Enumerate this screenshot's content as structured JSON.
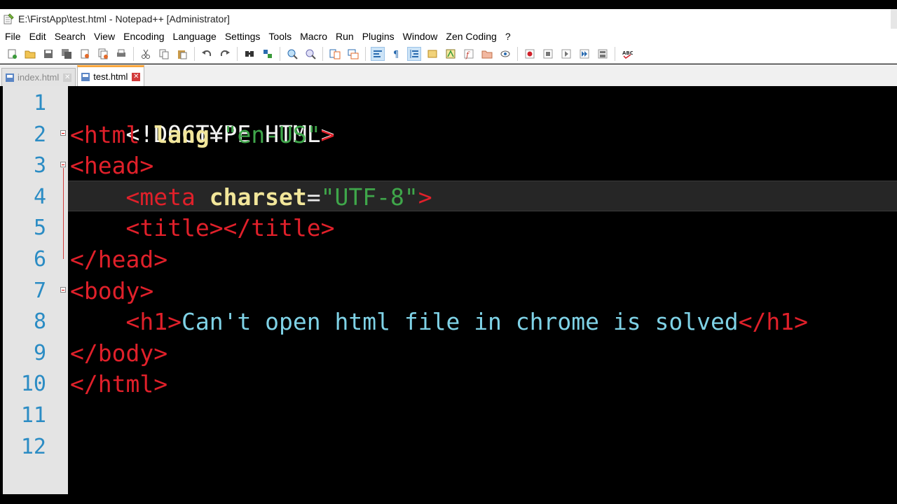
{
  "window": {
    "title": "E:\\FirstApp\\test.html - Notepad++ [Administrator]"
  },
  "menu": [
    "File",
    "Edit",
    "Search",
    "View",
    "Encoding",
    "Language",
    "Settings",
    "Tools",
    "Macro",
    "Run",
    "Plugins",
    "Window",
    "Zen Coding",
    "?"
  ],
  "toolbar_icons": [
    "new-file-icon",
    "open-file-icon",
    "save-icon",
    "save-all-icon",
    "close-icon",
    "close-all-icon",
    "print-icon",
    "cut-icon",
    "copy-icon",
    "paste-icon",
    "undo-icon",
    "redo-icon",
    "find-icon",
    "replace-icon",
    "zoom-in-icon",
    "zoom-out-icon",
    "sync-vertical-icon",
    "sync-horizontal-icon",
    "word-wrap-icon",
    "show-all-chars-icon",
    "indent-guide-icon",
    "doc-map-icon",
    "function-list-icon",
    "folder-workspace-icon",
    "monitor-icon",
    "record-macro-icon",
    "stop-record-icon",
    "play-macro-icon",
    "run-macro-multiple-icon",
    "save-macro-icon",
    "spell-check-icon"
  ],
  "tabs": [
    {
      "label": "index.html",
      "active": false
    },
    {
      "label": "test.html",
      "active": true
    }
  ],
  "editor": {
    "line_numbers": [
      "1",
      "2",
      "3",
      "4",
      "5",
      "6",
      "7",
      "8",
      "9",
      "10",
      "11",
      "12"
    ],
    "current_line": 4,
    "colors": {
      "tag": "#e0202a",
      "attribute": "#f2e69a",
      "string": "#3fa64a",
      "text": "#7fd2e6",
      "line_number": "#2b8cc4",
      "background": "#000000"
    },
    "lines": {
      "l1": {
        "doctype": "<!DOCTYPE HTML>"
      },
      "l2": {
        "open": "<html",
        "attr": "lang",
        "eq": "=",
        "val": "\"en-US\"",
        "close": ">"
      },
      "l3": {
        "tag": "<head>"
      },
      "l4": {
        "indent": "    ",
        "open": "<meta",
        "attr": "charset",
        "eq": "=",
        "val": "\"UTF-8\"",
        "close": ">"
      },
      "l5": {
        "indent": "    ",
        "tag": "<title></title>"
      },
      "l6": {
        "tag": "</head>"
      },
      "l7": {
        "tag": "<body>"
      },
      "l8": {
        "indent": "    ",
        "open": "<h1>",
        "text": "Can't open html file in chrome is solved",
        "close": "</h1>"
      },
      "l9": {
        "tag": "</body>"
      },
      "l10": {
        "tag": "</html>"
      }
    }
  }
}
